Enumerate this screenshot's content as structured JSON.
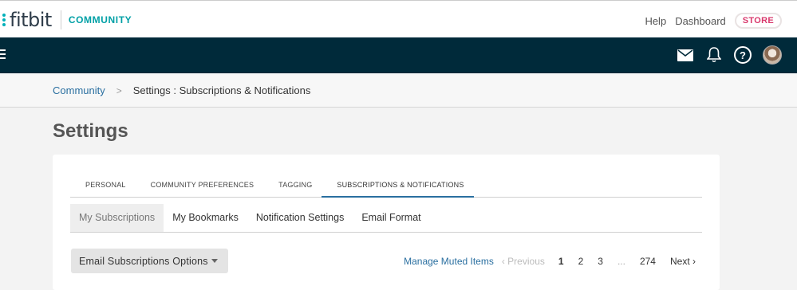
{
  "header": {
    "logo_text": "fitbit",
    "community_label": "COMMUNITY",
    "links": {
      "help": "Help",
      "dashboard": "Dashboard",
      "store": "STORE"
    },
    "brand_color": "#00b0b9"
  },
  "navbar": {
    "icons": [
      "menu-icon",
      "mail-icon",
      "bell-icon",
      "help-icon",
      "avatar"
    ],
    "help_glyph": "?",
    "background": "#002a3a"
  },
  "breadcrumb": {
    "root": "Community",
    "separator": ">",
    "current": "Settings : Subscriptions & Notifications"
  },
  "page": {
    "title": "Settings"
  },
  "main_tabs": [
    {
      "label": "PERSONAL",
      "active": false
    },
    {
      "label": "COMMUNITY PREFERENCES",
      "active": false
    },
    {
      "label": "TAGGING",
      "active": false
    },
    {
      "label": "SUBSCRIPTIONS & NOTIFICATIONS",
      "active": true
    }
  ],
  "sub_tabs": [
    {
      "label": "My Subscriptions",
      "active": true
    },
    {
      "label": "My Bookmarks",
      "active": false
    },
    {
      "label": "Notification Settings",
      "active": false
    },
    {
      "label": "Email Format",
      "active": false
    }
  ],
  "options_button": {
    "label": "Email Subscriptions Options"
  },
  "pagination": {
    "manage_muted": "Manage Muted Items",
    "previous": "‹ Previous",
    "pages": [
      "1",
      "2",
      "3"
    ],
    "current_page": "1",
    "ellipsis": "...",
    "last_page": "274",
    "next": "Next ›"
  }
}
